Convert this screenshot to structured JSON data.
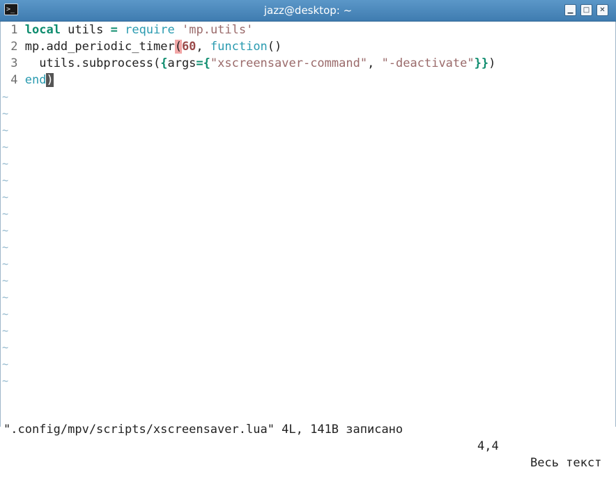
{
  "window": {
    "title": "jazz@desktop: ~",
    "icon": "terminal-icon",
    "buttons": {
      "minimize": "minimize-icon",
      "maximize": "maximize-icon",
      "close": "close-icon"
    }
  },
  "editor": {
    "lines": [
      {
        "number": "1",
        "tokens": [
          {
            "t": "local",
            "c": "kw"
          },
          {
            "t": " utils ",
            "c": ""
          },
          {
            "t": "=",
            "c": "op"
          },
          {
            "t": " ",
            "c": ""
          },
          {
            "t": "require",
            "c": "fn"
          },
          {
            "t": " ",
            "c": ""
          },
          {
            "t": "'mp.utils'",
            "c": "str"
          }
        ]
      },
      {
        "number": "2",
        "tokens": [
          {
            "t": "mp.add_periodic_timer",
            "c": ""
          },
          {
            "t": "(",
            "c": "match"
          },
          {
            "t": "60",
            "c": "num"
          },
          {
            "t": ", ",
            "c": ""
          },
          {
            "t": "function",
            "c": "fn"
          },
          {
            "t": "()",
            "c": ""
          }
        ]
      },
      {
        "number": "3",
        "tokens": [
          {
            "t": "  utils.subprocess(",
            "c": ""
          },
          {
            "t": "{",
            "c": "op"
          },
          {
            "t": "args",
            "c": ""
          },
          {
            "t": "={",
            "c": "op"
          },
          {
            "t": "\"xscreensaver-command\"",
            "c": "str"
          },
          {
            "t": ", ",
            "c": ""
          },
          {
            "t": "\"-deactivate\"",
            "c": "str"
          },
          {
            "t": "}}",
            "c": "op"
          },
          {
            "t": ")",
            "c": ""
          }
        ]
      },
      {
        "number": "4",
        "tokens": [
          {
            "t": "end",
            "c": "fn"
          },
          {
            "t": ")",
            "c": "cursor"
          }
        ]
      }
    ],
    "empty_marker": "~",
    "empty_count": 18
  },
  "status": {
    "message": "\".config/mpv/scripts/xscreensaver.lua\" 4L, 141B записано",
    "position": "4,4",
    "scroll": "Весь текст"
  }
}
